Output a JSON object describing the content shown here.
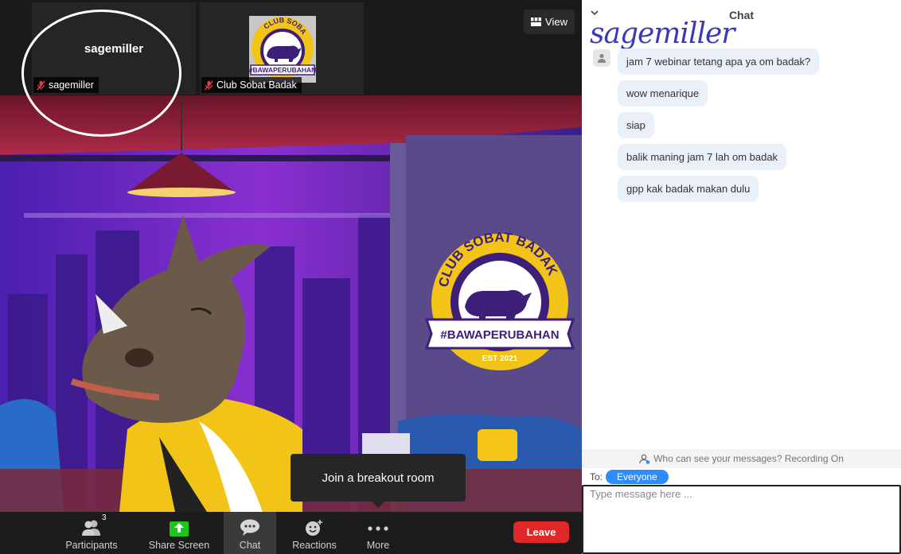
{
  "participants_strip": {
    "self": {
      "big_name": "sagemiller",
      "label": "sagemiller"
    },
    "host": {
      "label": "Club Sobat Badak",
      "logo_top_text": "CLUB SOBAT BADAK",
      "logo_hashtag": "#BAWAPERUBAHAN"
    }
  },
  "view_button": {
    "label": "View"
  },
  "main_video": {
    "logo_top_text": "CLUB SOBAT BADAK",
    "logo_hashtag": "#BAWAPERUBAHAN",
    "logo_est": "EST 2021"
  },
  "breakout_tooltip": "Join a breakout room",
  "toolbar": {
    "participants": {
      "label": "Participants",
      "count": "3"
    },
    "share_screen": {
      "label": "Share Screen"
    },
    "chat": {
      "label": "Chat"
    },
    "reactions": {
      "label": "Reactions"
    },
    "more": {
      "label": "More"
    },
    "leave": {
      "label": "Leave"
    }
  },
  "chat": {
    "title": "Chat",
    "handwritten_annotation": "sagemiller",
    "messages": [
      "jam 7 webinar tetang apa ya om badak?",
      "wow menarique",
      "siap",
      "balik maning jam 7 lah om badak",
      "gpp kak badak makan dulu"
    ],
    "privacy_notice": "Who can see your messages? Recording On",
    "to_label": "To:",
    "recipient": "Everyone",
    "input_placeholder": "Type message here ..."
  },
  "colors": {
    "leave": "#e02828",
    "recipient_pill": "#2d8cff",
    "share_screen_icon": "#21c321",
    "message_bubble": "#eaf0f8",
    "logo_yellow": "#f2c418",
    "logo_purple": "#3d1f7a"
  },
  "icons": {
    "mic_muted": "mic-off-icon",
    "view": "grid-icon",
    "participants": "people-icon",
    "share_screen": "share-screen-icon",
    "chat": "chat-bubble-icon",
    "reactions": "smiley-plus-icon",
    "more": "dots-icon",
    "avatar": "person-icon",
    "privacy": "person-question-icon",
    "collapse": "chevron-down-icon"
  }
}
